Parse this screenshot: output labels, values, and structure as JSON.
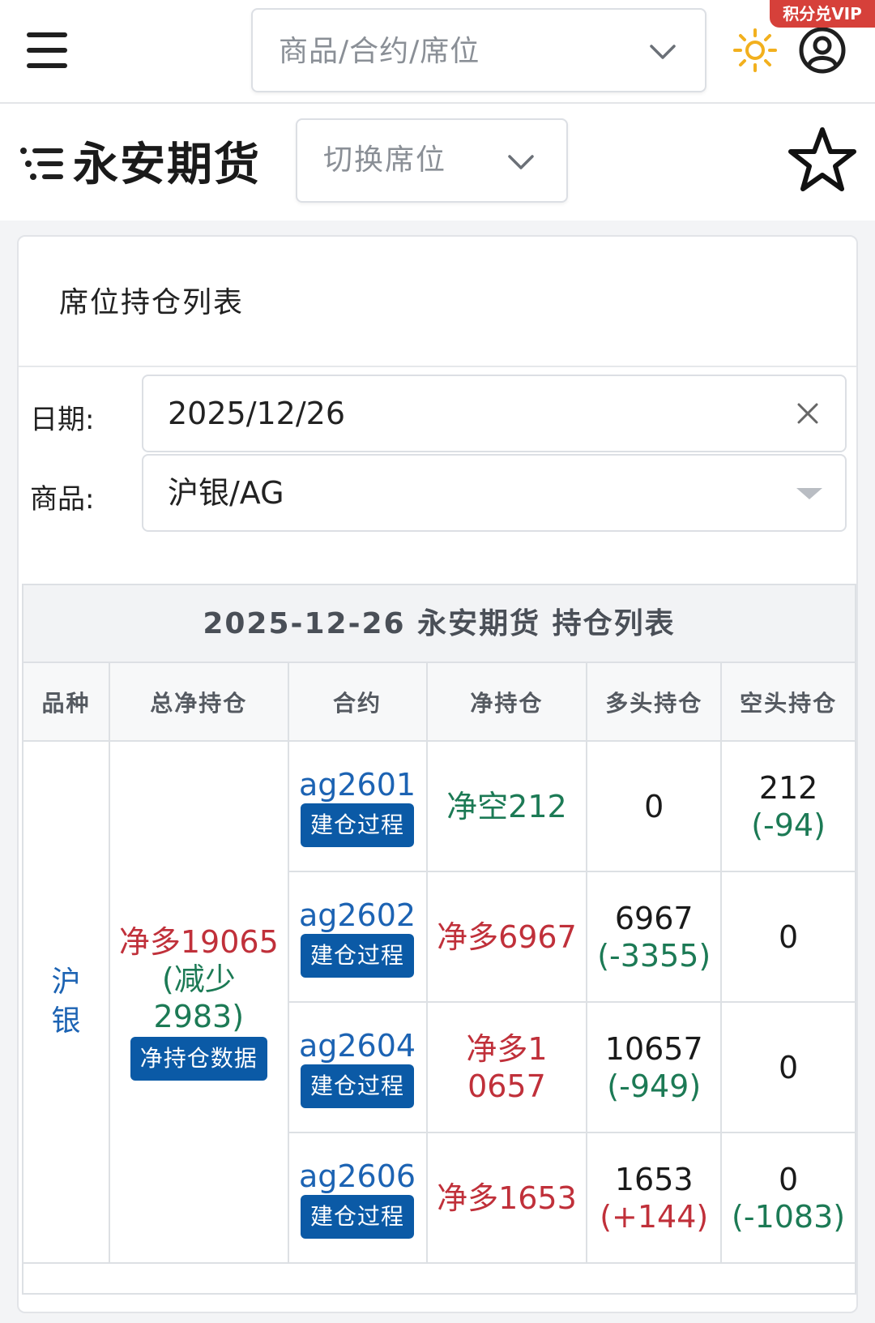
{
  "header": {
    "search_placeholder": "商品/合约/席位",
    "vip_label": "积分兑VIP"
  },
  "broker": {
    "name": "永安期货",
    "seat_placeholder": "切换席位"
  },
  "card": {
    "title": "席位持仓列表",
    "date_label": "日期:",
    "date_value": "2025/12/26",
    "product_label": "商品:",
    "product_value": "沪银/AG"
  },
  "table": {
    "caption": "2025-12-26 永安期货 持仓列表",
    "headers": [
      "品种",
      "总净持仓",
      "合约",
      "净持仓",
      "多头持仓",
      "空头持仓"
    ],
    "variety": "沪银",
    "total_net_line1": "净多19065",
    "total_net_line2": "(减少",
    "total_net_line3": "2983)",
    "net_data_button": "净持仓数据",
    "build_button": "建仓过程",
    "rows": [
      {
        "contract": "ag2601",
        "net": "净空212",
        "long": "0",
        "long_change": "",
        "short": "212",
        "short_change": "(-94)"
      },
      {
        "contract": "ag2602",
        "net": "净多6967",
        "long": "6967",
        "long_change": "(-3355)",
        "short": "0",
        "short_change": ""
      },
      {
        "contract": "ag2604",
        "net": "净多10657",
        "long": "10657",
        "long_change": "(-949)",
        "short": "0",
        "short_change": ""
      },
      {
        "contract": "ag2606",
        "net": "净多1653",
        "long": "1653",
        "long_change": "(+144)",
        "short": "0",
        "short_change": "(-1083)"
      }
    ]
  },
  "colors": {
    "accent_blue": "#0b5aa6",
    "net_long_red": "#c0303a",
    "net_short_green": "#1c7a55",
    "sun_yellow": "#f2b01e",
    "vip_red": "#d6403a"
  }
}
